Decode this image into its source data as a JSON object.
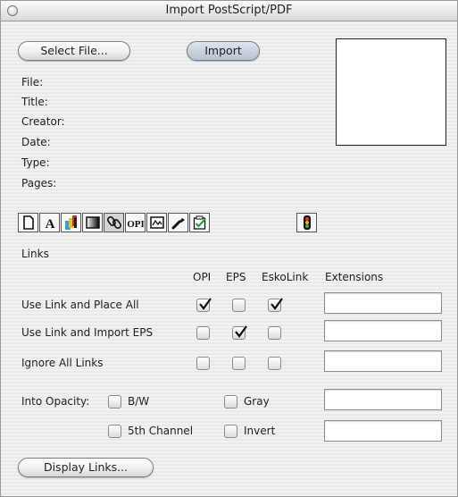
{
  "window": {
    "title": "Import PostScript/PDF"
  },
  "buttons": {
    "select_file": "Select File...",
    "import": "Import",
    "display_links": "Display Links..."
  },
  "info": {
    "file": "File:",
    "title": "Title:",
    "creator": "Creator:",
    "date": "Date:",
    "type": "Type:",
    "pages": "Pages:"
  },
  "toolbar": {
    "icons": [
      "page-icon",
      "font-icon",
      "color-separation-icon",
      "gradient-icon",
      "links-icon",
      "opi-icon",
      "image-icon",
      "wrench-icon",
      "checklist-icon",
      "traffic-light-icon"
    ],
    "selected": "links-icon",
    "opi_label": "OPI"
  },
  "links": {
    "section_label": "Links",
    "columns": [
      "OPI",
      "EPS",
      "EskoLink",
      "Extensions"
    ],
    "rows": [
      {
        "label": "Use Link and Place All",
        "opi": true,
        "eps": false,
        "eskolink": true,
        "extensions": ""
      },
      {
        "label": "Use Link and Import EPS",
        "opi": false,
        "eps": true,
        "eskolink": false,
        "extensions": ""
      },
      {
        "label": "Ignore All Links",
        "opi": false,
        "eps": false,
        "eskolink": false,
        "extensions": ""
      }
    ]
  },
  "opacity": {
    "label": "Into Opacity:",
    "bw": {
      "label": "B/W",
      "checked": false
    },
    "gray": {
      "label": "Gray",
      "checked": false
    },
    "fifth": {
      "label": "5th Channel",
      "checked": false
    },
    "invert": {
      "label": "Invert",
      "checked": false
    },
    "field1": "",
    "field2": ""
  }
}
